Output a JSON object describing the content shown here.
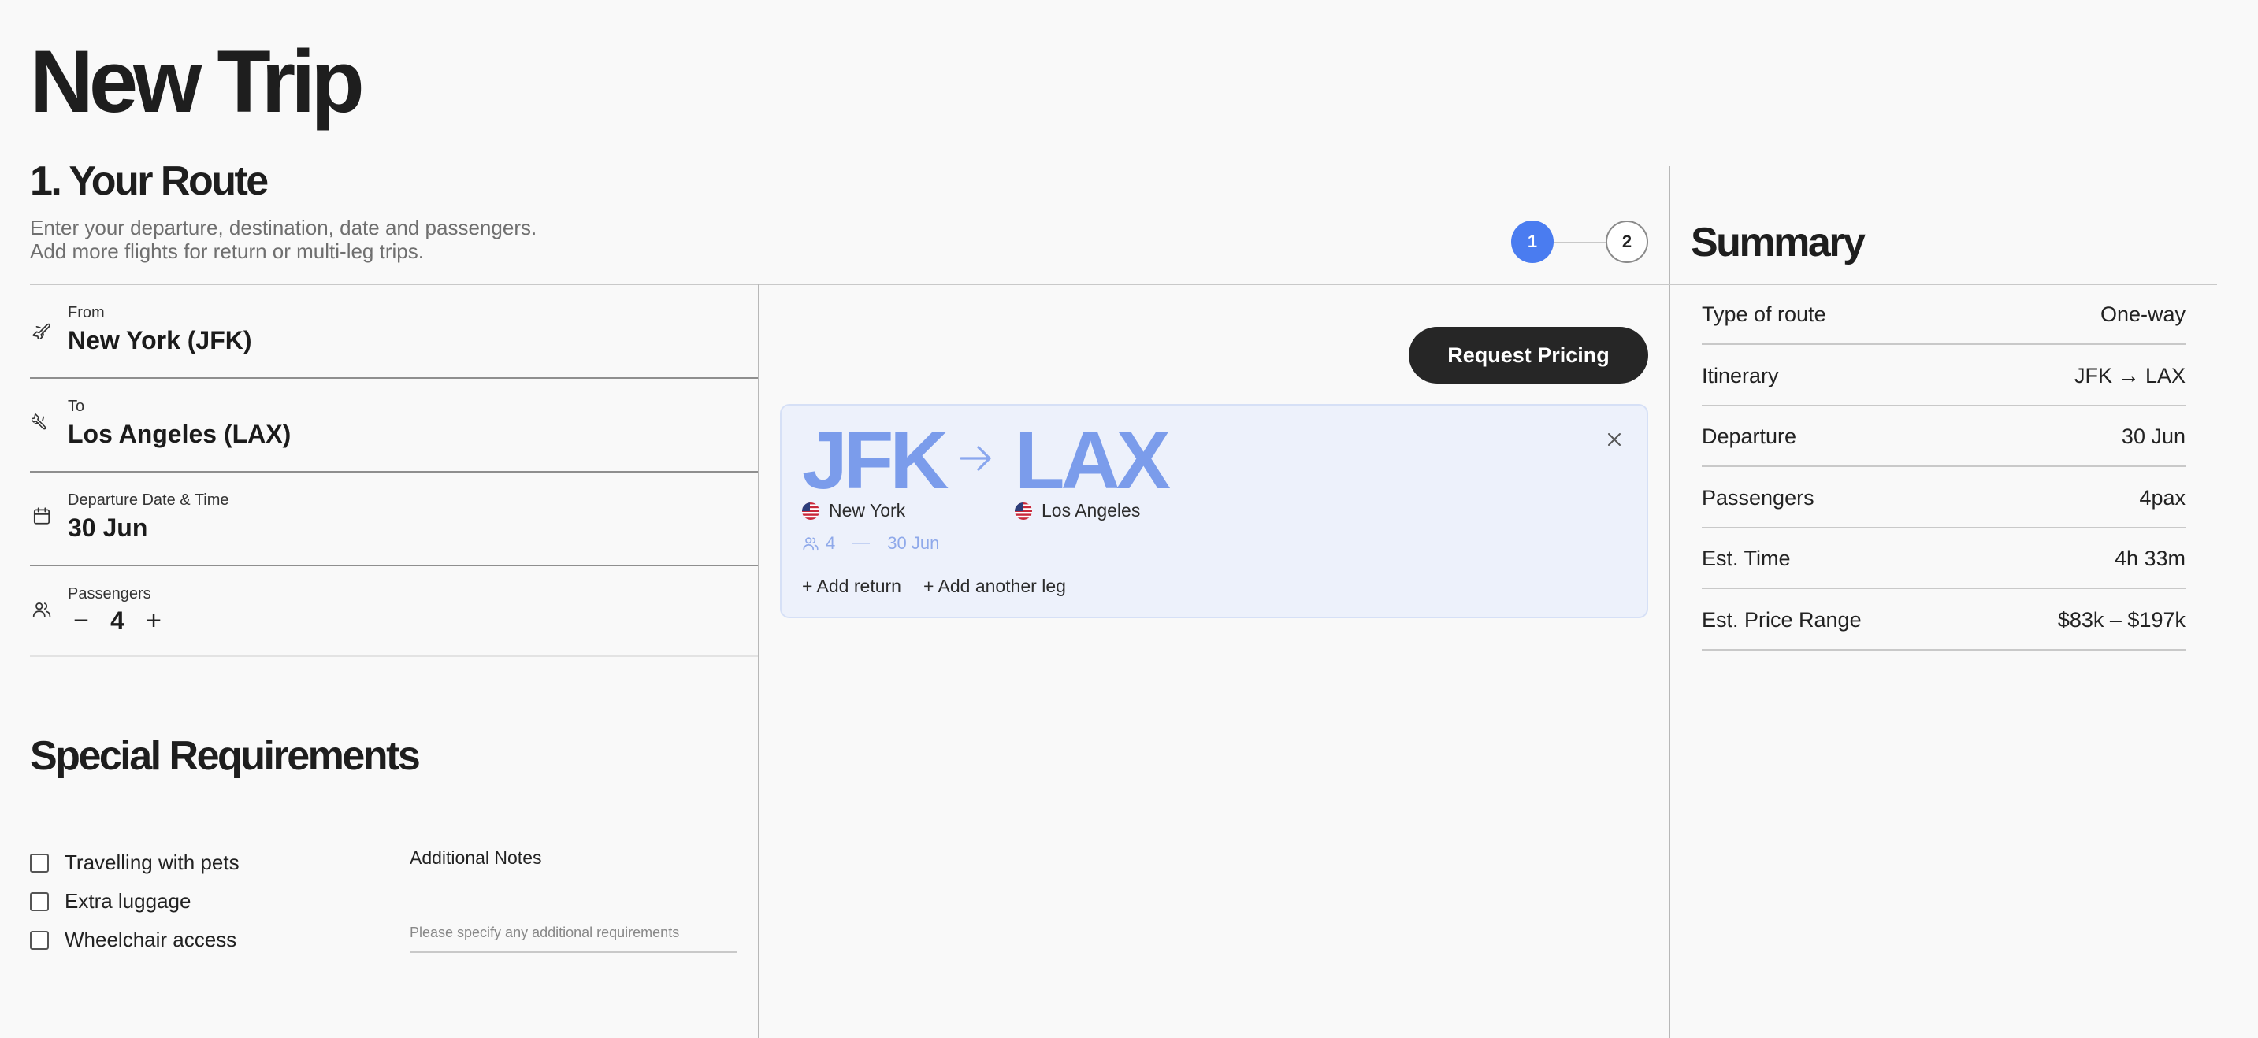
{
  "page": {
    "title": "New Trip"
  },
  "route_section": {
    "title": "1. Your Route",
    "intro_line1": "Enter your departure, destination, date and passengers.",
    "intro_line2": "Add more flights for return or multi-leg trips."
  },
  "stepper": {
    "steps": [
      "1",
      "2"
    ],
    "active_step": "1",
    "active_color": "#4a7cf0"
  },
  "form": {
    "from": {
      "label": "From",
      "value": "New York (JFK)",
      "icon": "plane-takeoff-icon"
    },
    "to": {
      "label": "To",
      "value": "Los Angeles (LAX)",
      "icon": "plane-landing-icon"
    },
    "date": {
      "label": "Departure Date & Time",
      "value": "30 Jun",
      "icon": "calendar-icon"
    },
    "passengers": {
      "label": "Passengers",
      "value": "4",
      "decrement": "−",
      "increment": "+",
      "icon": "users-icon"
    }
  },
  "special": {
    "title": "Special Requirements",
    "options": [
      {
        "label": "Travelling with pets",
        "checked": false
      },
      {
        "label": "Extra luggage",
        "checked": false
      },
      {
        "label": "Wheelchair access",
        "checked": false
      }
    ],
    "notes_label": "Additional Notes",
    "notes_placeholder": "Please specify any additional requirements",
    "notes_value": ""
  },
  "actions": {
    "request_pricing": "Request Pricing"
  },
  "route_card": {
    "from_code": "JFK",
    "to_code": "LAX",
    "from_city": "New York",
    "to_city": "Los Angeles",
    "passengers": "4",
    "date": "30 Jun",
    "add_return": "+ Add return",
    "add_leg": "+ Add another leg",
    "accent_color": "#7b9ceb",
    "background_color": "#edf1fb"
  },
  "summary": {
    "title": "Summary",
    "rows": [
      {
        "label": "Type of route",
        "value": "One-way"
      },
      {
        "label": "Itinerary",
        "value": "JFK → LAX"
      },
      {
        "label": "Departure",
        "value": "30 Jun"
      },
      {
        "label": "Passengers",
        "value": "4pax"
      },
      {
        "label": "Est. Time",
        "value": "4h 33m"
      },
      {
        "label": "Est. Price Range",
        "value": "$83k – $197k"
      }
    ]
  }
}
